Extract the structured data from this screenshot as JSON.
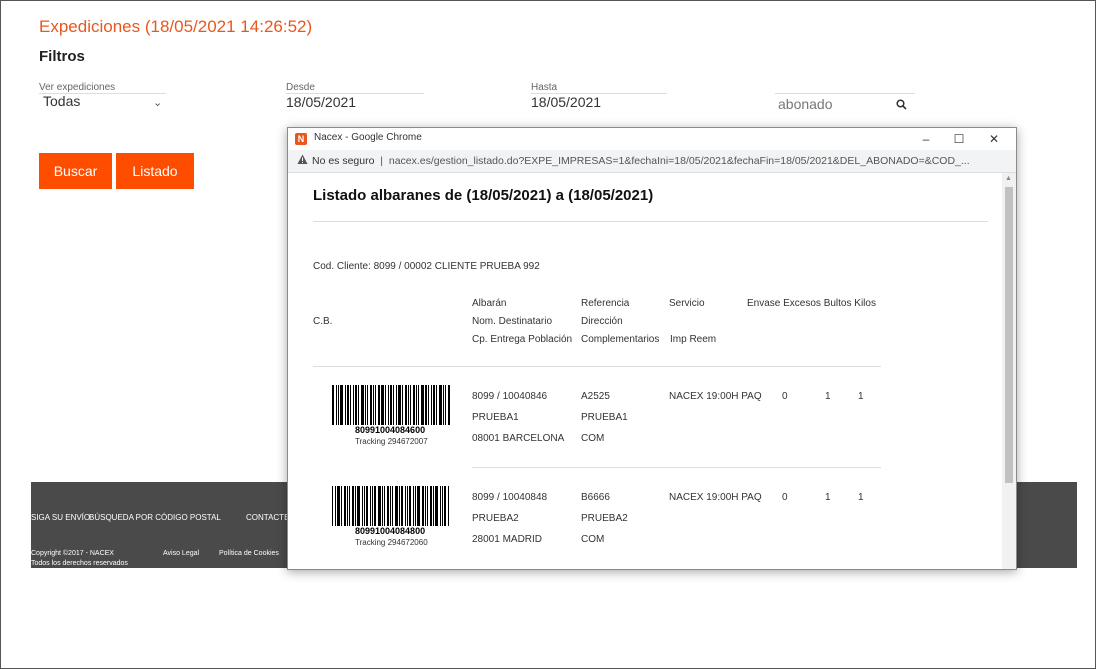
{
  "page": {
    "title": "Expediciones (18/05/2021 14:26:52)",
    "filters_title": "Filtros"
  },
  "filters": {
    "ver_label": "Ver expediciones",
    "ver_value": "Todas",
    "desde_label": "Desde",
    "desde_value": "18/05/2021",
    "hasta_label": "Hasta",
    "hasta_value": "18/05/2021",
    "abonado_value": "abonado"
  },
  "buttons": {
    "buscar": "Buscar",
    "listado": "Listado"
  },
  "footer": {
    "links": [
      "SIGA SU ENVÍO",
      "BÚSQUEDA POR CÓDIGO POSTAL",
      "CONTACTE C"
    ],
    "copyright": "Copyright ©2017 - NACEX",
    "rights": "Todos los derechos reservados",
    "aviso": "Aviso Legal",
    "cookies": "Política de Cookies"
  },
  "popup": {
    "window_title": "Nacex - Google Chrome",
    "app_icon": "N",
    "not_secure": "No es seguro",
    "url": "nacex.es/gestion_listado.do?EXPE_IMPRESAS=1&fechaIni=18/05/2021&fechaFin=18/05/2021&DEL_ABONADO=&COD_...",
    "doc_title": "Listado albaranes de (18/05/2021) a (18/05/2021)",
    "cliente": "Cod. Cliente: 8099 / 00002  CLIENTE PRUEBA 992",
    "headers": {
      "cb": "C.B.",
      "albaran": "Albarán",
      "nom_destinatario": "Nom. Destinatario",
      "cp_entrega": "Cp. Entrega Población",
      "referencia": "Referencia",
      "direccion": "Dirección",
      "complementarios": "Complementarios",
      "servicio": "Servicio",
      "imp_reem": "Imp Reem",
      "cols_right": "Envase Excesos Bultos Kilos"
    },
    "rows": [
      {
        "barcode_number": "80991004084600",
        "tracking": "Tracking 294672007",
        "albaran": "8099 / 10040846",
        "destinatario": "PRUEBA1",
        "cp_poblacion": "08001 BARCELONA",
        "referencia": "A2525",
        "direccion": "PRUEBA1",
        "complementarios": "COM",
        "servicio": "NACEX 19:00H PAQ",
        "envase": "0",
        "bultos": "1",
        "kilos": "1"
      },
      {
        "barcode_number": "80991004084800",
        "tracking": "Tracking 294672060",
        "albaran": "8099 / 10040848",
        "destinatario": "PRUEBA2",
        "cp_poblacion": "28001 MADRID",
        "referencia": "B6666",
        "direccion": "PRUEBA2",
        "complementarios": "COM",
        "servicio": "NACEX 19:00H PAQ",
        "envase": "0",
        "bultos": "1",
        "kilos": "1"
      }
    ]
  },
  "colors": {
    "accent": "#ff4d00",
    "title": "#e8571c",
    "footer_bg": "#4a4a4a"
  },
  "icons": [
    "search-icon",
    "chevron-down-icon",
    "warning-icon",
    "minimize-icon",
    "maximize-icon",
    "close-icon"
  ]
}
